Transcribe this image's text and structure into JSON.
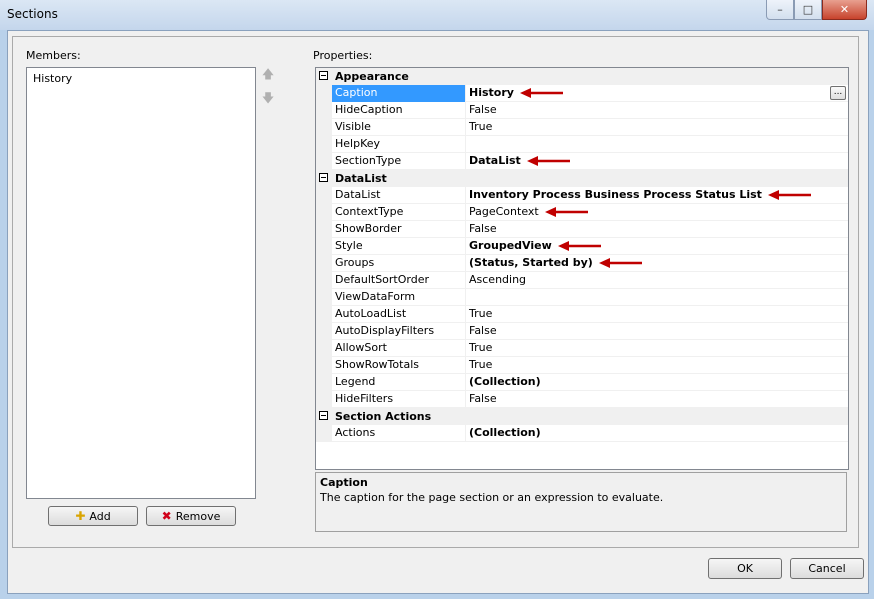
{
  "window": {
    "title": "Sections"
  },
  "members": {
    "label": "Members:",
    "items": [
      "History"
    ]
  },
  "buttons": {
    "add": "Add",
    "remove": "Remove",
    "ok": "OK",
    "cancel": "Cancel"
  },
  "properties": {
    "label": "Properties:",
    "categories": [
      {
        "name": "Appearance",
        "rows": [
          {
            "name": "Caption",
            "value": "History",
            "bold": true,
            "selected": true,
            "ellipsis": true,
            "arrow": true
          },
          {
            "name": "HideCaption",
            "value": "False"
          },
          {
            "name": "Visible",
            "value": "True"
          },
          {
            "name": "HelpKey",
            "value": ""
          },
          {
            "name": "SectionType",
            "value": "DataList",
            "bold": true,
            "arrow": true
          }
        ]
      },
      {
        "name": "DataList",
        "rows": [
          {
            "name": "DataList",
            "value": "Inventory Process Business Process Status List",
            "bold": true,
            "arrow": true
          },
          {
            "name": "ContextType",
            "value": "PageContext",
            "arrow": true
          },
          {
            "name": "ShowBorder",
            "value": "False"
          },
          {
            "name": "Style",
            "value": "GroupedView",
            "bold": true,
            "arrow": true
          },
          {
            "name": "Groups",
            "value": "(Status, Started by)",
            "bold": true,
            "arrow": true
          },
          {
            "name": "DefaultSortOrder",
            "value": "Ascending"
          },
          {
            "name": "ViewDataForm",
            "value": ""
          },
          {
            "name": "AutoLoadList",
            "value": "True"
          },
          {
            "name": "AutoDisplayFilters",
            "value": "False"
          },
          {
            "name": "AllowSort",
            "value": "True"
          },
          {
            "name": "ShowRowTotals",
            "value": "True"
          },
          {
            "name": "Legend",
            "value": "(Collection)",
            "bold": true
          },
          {
            "name": "HideFilters",
            "value": "False"
          }
        ]
      },
      {
        "name": "Section Actions",
        "rows": [
          {
            "name": "Actions",
            "value": "(Collection)",
            "bold": true
          }
        ]
      }
    ]
  },
  "help": {
    "title": "Caption",
    "description": "The caption for the page section or an expression to evaluate."
  },
  "colors": {
    "selection": "#3399ff",
    "arrow": "#c00000"
  }
}
